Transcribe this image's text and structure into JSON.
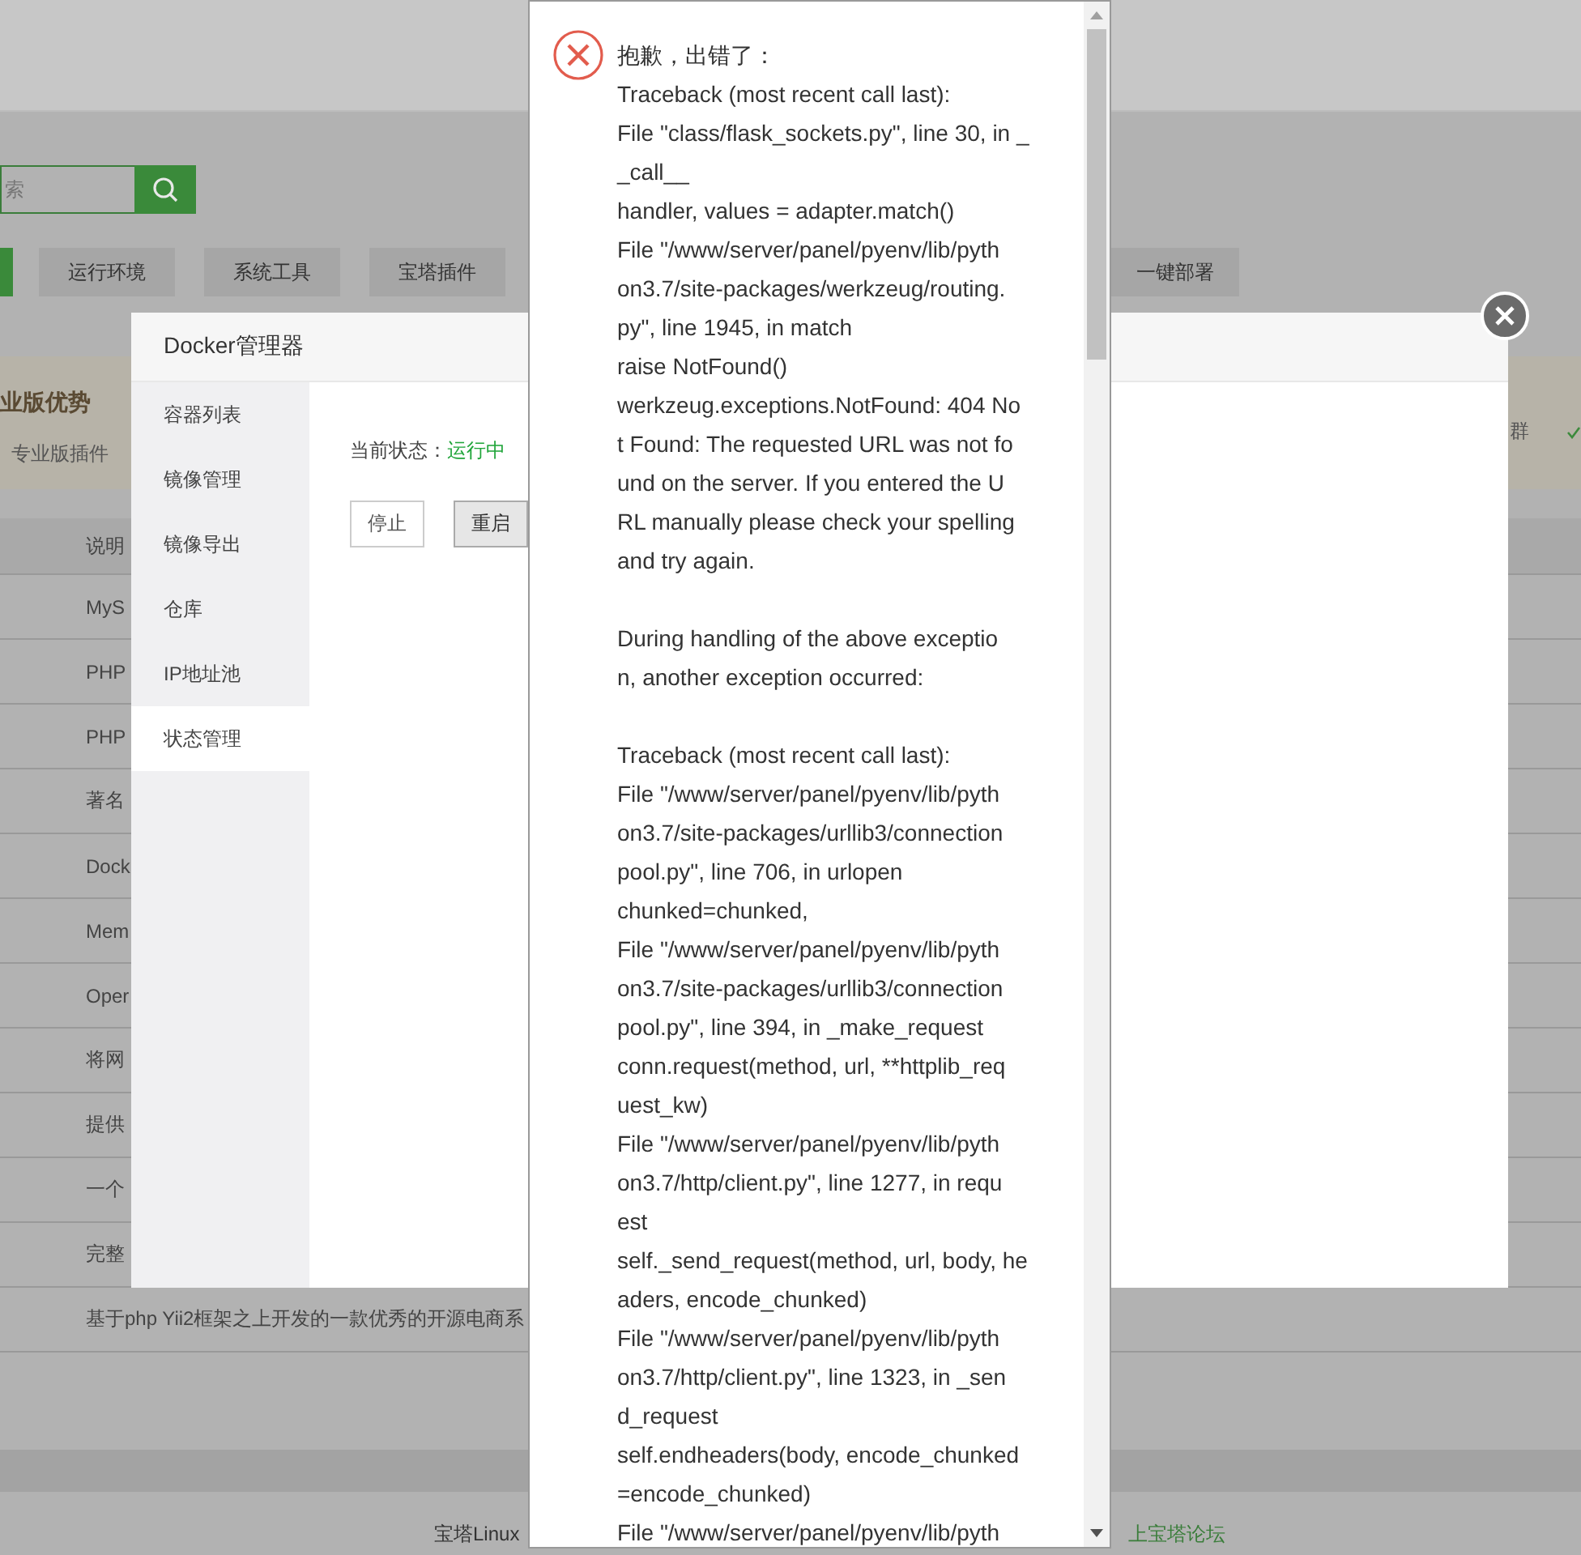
{
  "page": {
    "search": {
      "placeholder": "索"
    },
    "categories": [
      {
        "selected": true
      },
      {
        "label": "运行环境",
        "selected": false
      },
      {
        "label": "系统工具",
        "selected": false
      },
      {
        "label": "宝塔插件",
        "selected": false
      },
      {
        "label": "一键部署",
        "selected": false
      }
    ],
    "promo": {
      "title": "业版优势",
      "tab": "专业版插件",
      "right_text": "群"
    },
    "table": {
      "columns": [
        "说明"
      ],
      "rows": [
        "MyS",
        "PHP",
        "PHP",
        "著名",
        "Dock",
        "Mem",
        "Oper",
        "将网",
        "提供",
        "一个",
        "完整",
        "基于php Yii2框架之上开发的一款优秀的开源电商系"
      ]
    },
    "footer": {
      "text": "宝塔Linux",
      "link": "上宝塔论坛"
    }
  },
  "docker_modal": {
    "title": "Docker管理器",
    "sidebar": [
      {
        "label": "容器列表",
        "selected": false
      },
      {
        "label": "镜像管理",
        "selected": false
      },
      {
        "label": "镜像导出",
        "selected": false
      },
      {
        "label": "仓库",
        "selected": false
      },
      {
        "label": "IP地址池",
        "selected": false
      },
      {
        "label": "状态管理",
        "selected": true
      }
    ],
    "status_label": "当前状态：",
    "status_value": "运行中",
    "buttons": [
      {
        "label": "停止",
        "kind": "default"
      },
      {
        "label": "重启",
        "kind": "pressed"
      }
    ]
  },
  "error_dialog": {
    "title": "抱歉，出错了：",
    "paragraphs": [
      [
        "Traceback (most recent call last):",
        "File \"class/flask_sockets.py\", line 30, in _",
        "_call__",
        "handler, values = adapter.match()",
        "File \"/www/server/panel/pyenv/lib/pyth",
        "on3.7/site-packages/werkzeug/routing.",
        "py\", line 1945, in match",
        "raise NotFound()",
        "werkzeug.exceptions.NotFound: 404 No",
        "t Found: The requested URL was not fo",
        "und on the server. If you entered the U",
        "RL manually please check your spelling",
        "and try again."
      ],
      [
        "During handling of the above exceptio",
        "n, another exception occurred:"
      ],
      [
        "Traceback (most recent call last):",
        "File \"/www/server/panel/pyenv/lib/pyth",
        "on3.7/site-packages/urllib3/connection",
        "pool.py\", line 706, in urlopen",
        "chunked=chunked,",
        "File \"/www/server/panel/pyenv/lib/pyth",
        "on3.7/site-packages/urllib3/connection",
        "pool.py\", line 394, in _make_request",
        "conn.request(method, url, **httplib_req",
        "uest_kw)",
        "File \"/www/server/panel/pyenv/lib/pyth",
        "on3.7/http/client.py\", line 1277, in requ",
        "est",
        "self._send_request(method, url, body, he",
        "aders, encode_chunked)",
        "File \"/www/server/panel/pyenv/lib/pyth",
        "on3.7/http/client.py\", line 1323, in _sen",
        "d_request",
        "self.endheaders(body, encode_chunked",
        "=encode_chunked)",
        "File \"/www/server/panel/pyenv/lib/pyth"
      ]
    ]
  }
}
